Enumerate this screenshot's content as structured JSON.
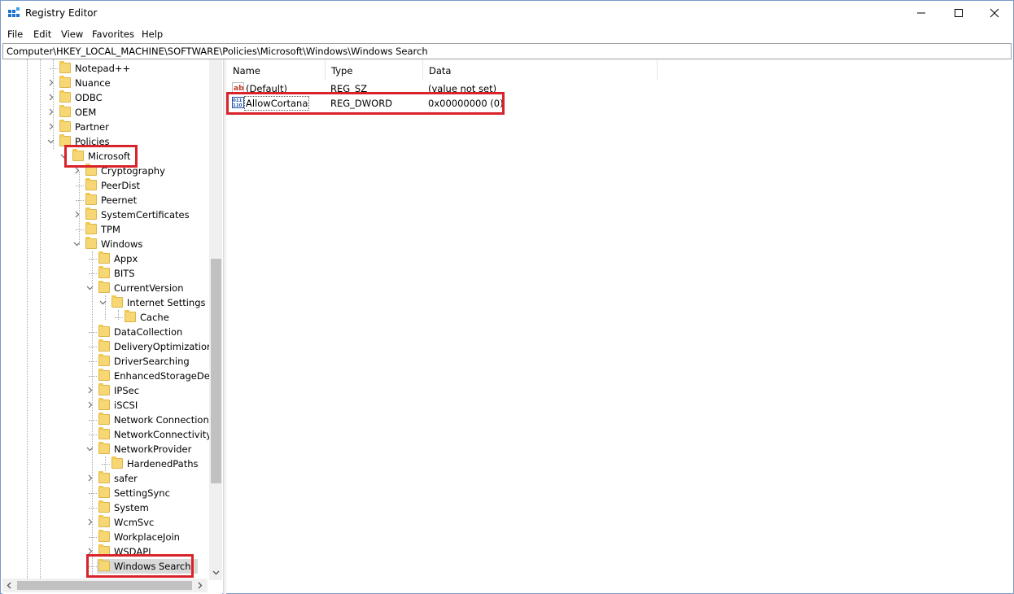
{
  "window": {
    "title": "Registry Editor",
    "minimize_glyph": "—",
    "maximize_glyph": "☐",
    "close_glyph": "✕"
  },
  "menu": [
    "File",
    "Edit",
    "View",
    "Favorites",
    "Help"
  ],
  "address": "Computer\\HKEY_LOCAL_MACHINE\\SOFTWARE\\Policies\\Microsoft\\Windows\\Windows Search",
  "tree": [
    {
      "label": "Notepad++",
      "level": 0,
      "expander": ""
    },
    {
      "label": "Nuance",
      "level": 0,
      "expander": ">"
    },
    {
      "label": "ODBC",
      "level": 0,
      "expander": ">"
    },
    {
      "label": "OEM",
      "level": 0,
      "expander": ">"
    },
    {
      "label": "Partner",
      "level": 0,
      "expander": ">"
    },
    {
      "label": "Policies",
      "level": 0,
      "expander": "v"
    },
    {
      "label": "Microsoft",
      "level": 1,
      "expander": "v"
    },
    {
      "label": "Cryptography",
      "level": 2,
      "expander": ">"
    },
    {
      "label": "PeerDist",
      "level": 2,
      "expander": ""
    },
    {
      "label": "Peernet",
      "level": 2,
      "expander": ""
    },
    {
      "label": "SystemCertificates",
      "level": 2,
      "expander": ">"
    },
    {
      "label": "TPM",
      "level": 2,
      "expander": ""
    },
    {
      "label": "Windows",
      "level": 2,
      "expander": "v"
    },
    {
      "label": "Appx",
      "level": 3,
      "expander": ""
    },
    {
      "label": "BITS",
      "level": 3,
      "expander": ""
    },
    {
      "label": "CurrentVersion",
      "level": 3,
      "expander": "v"
    },
    {
      "label": "Internet Settings",
      "level": 4,
      "expander": "v"
    },
    {
      "label": "Cache",
      "level": 5,
      "expander": ""
    },
    {
      "label": "DataCollection",
      "level": 3,
      "expander": ""
    },
    {
      "label": "DeliveryOptimization",
      "level": 3,
      "expander": ""
    },
    {
      "label": "DriverSearching",
      "level": 3,
      "expander": ""
    },
    {
      "label": "EnhancedStorageDevi",
      "level": 3,
      "expander": ""
    },
    {
      "label": "IPSec",
      "level": 3,
      "expander": ">"
    },
    {
      "label": "iSCSI",
      "level": 3,
      "expander": ">"
    },
    {
      "label": "Network Connections",
      "level": 3,
      "expander": ""
    },
    {
      "label": "NetworkConnectivityS",
      "level": 3,
      "expander": ""
    },
    {
      "label": "NetworkProvider",
      "level": 3,
      "expander": "v"
    },
    {
      "label": "HardenedPaths",
      "level": 4,
      "expander": ""
    },
    {
      "label": "safer",
      "level": 3,
      "expander": ">"
    },
    {
      "label": "SettingSync",
      "level": 3,
      "expander": ""
    },
    {
      "label": "System",
      "level": 3,
      "expander": ""
    },
    {
      "label": "WcmSvc",
      "level": 3,
      "expander": ">"
    },
    {
      "label": "WorkplaceJoin",
      "level": 3,
      "expander": ""
    },
    {
      "label": "WSDAPI",
      "level": 3,
      "expander": ">"
    },
    {
      "label": "Windows Search",
      "level": 3,
      "expander": ""
    }
  ],
  "list": {
    "columns": [
      "Name",
      "Type",
      "Data"
    ],
    "rows": [
      {
        "icon": "string-value-icon",
        "icon_text": "ab",
        "name": "(Default)",
        "type": "REG_SZ",
        "data": "(value not set)"
      },
      {
        "icon": "dword-value-icon",
        "icon_text": "011",
        "name": "AllowCortana",
        "type": "REG_DWORD",
        "data": "0x00000000 (0)"
      }
    ]
  },
  "colors": {
    "highlight": "#d9232a",
    "folder": "#f7d774"
  }
}
